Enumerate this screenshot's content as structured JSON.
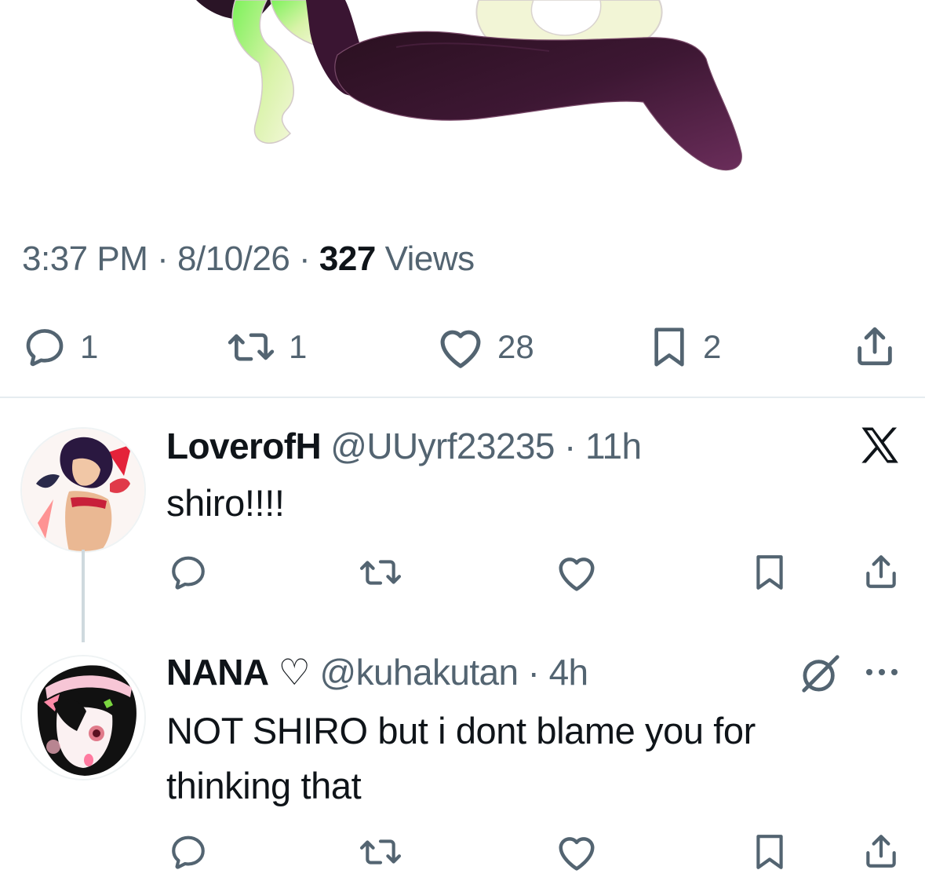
{
  "tweet": {
    "time": "3:37 PM",
    "sep1": " · ",
    "date": "8/10/26",
    "sep2": " · ",
    "views_count": "327",
    "views_label": "Views",
    "stats": {
      "replies": "1",
      "retweets": "1",
      "likes": "28",
      "bookmarks": "2"
    }
  },
  "replies": [
    {
      "name": "LoverofH",
      "handle": "@UUyrf23235",
      "dot": " · ",
      "age": "11h",
      "text": "shiro!!!!",
      "badge_icon": "x-logo-icon"
    },
    {
      "name": "NANA",
      "name_suffix": "♡",
      "handle": "@kuhakutan",
      "dot": " · ",
      "age": "4h",
      "text": "NOT SHIRO but i dont blame you for thinking that",
      "badge_icon": "grok-icon",
      "menu_icon": "more-icon"
    }
  ],
  "colors": {
    "text": "#0f1419",
    "secondary": "#536471",
    "divider": "#e6ecf0",
    "thread_line": "#cfd9de",
    "illustration_purple": "#4a2040",
    "illustration_green": "#9af06a"
  }
}
